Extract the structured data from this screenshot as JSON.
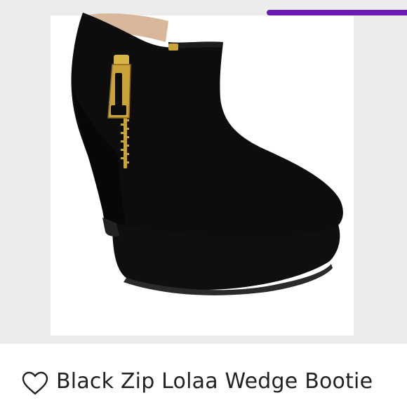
{
  "listing": {
    "title": "Black Zip Lolaa Wedge Bootie",
    "image_subject": "black suede wedge ankle bootie with gold side zipper"
  },
  "icons": {
    "like": "heart-outline-icon"
  },
  "colors": {
    "accent": "#6a1bb5",
    "image_background": "#ececec",
    "shoe": "#0d0d0d",
    "zipper": "#c9a23a",
    "text": "#222222"
  }
}
